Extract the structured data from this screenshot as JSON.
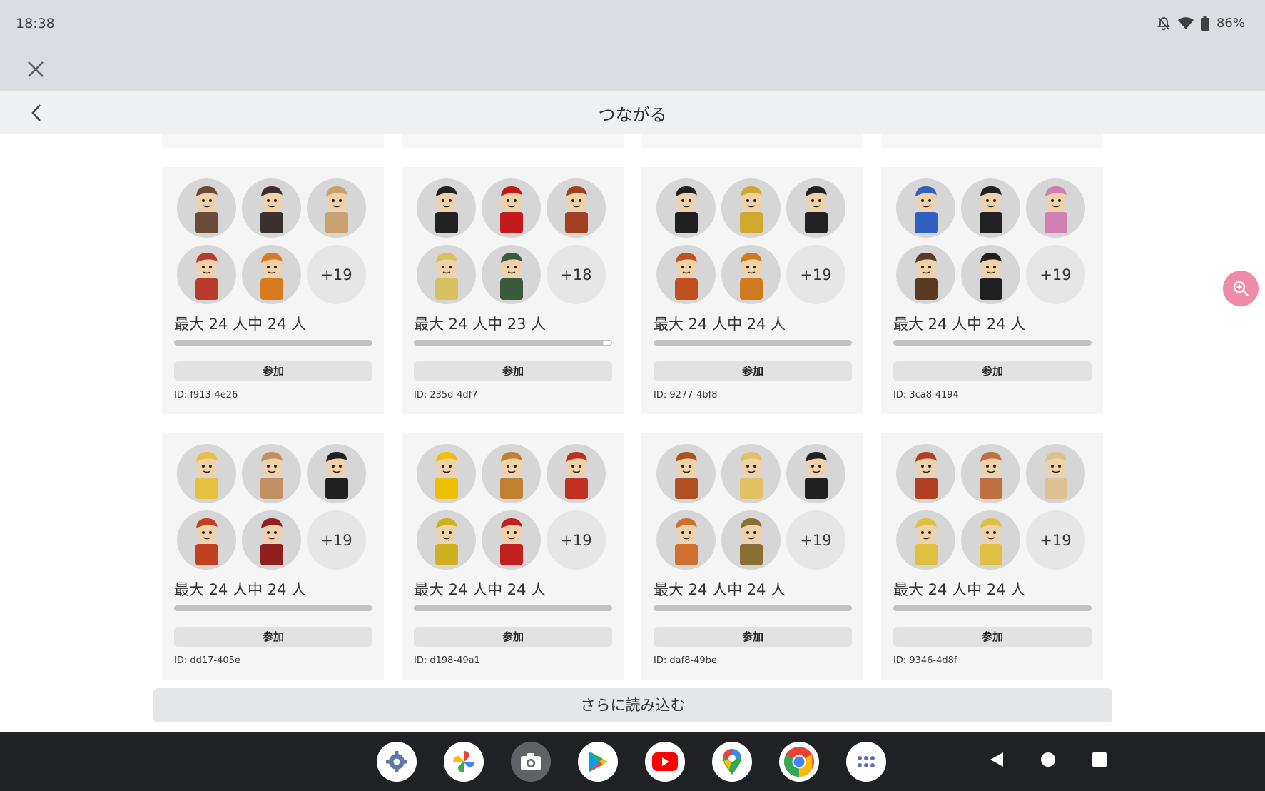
{
  "status_bar": {
    "time": "18:38",
    "battery": "86%"
  },
  "header": {
    "title": "つながる"
  },
  "servers": [
    {
      "avatar_colors": [
        "#6b4a3a",
        "#3a3030",
        "#c9a070",
        "#b83a2a",
        "#d87a20"
      ],
      "more": "+19",
      "count_text": "最大 24 人中 24 人",
      "fill": 1.0,
      "join_label": "参加",
      "id_text": "ID: f913-4e26"
    },
    {
      "avatar_colors": [
        "#222222",
        "#c21a1a",
        "#a04020",
        "#d8c060",
        "#3a5a3a"
      ],
      "more": "+18",
      "count_text": "最大 24 人中 23 人",
      "fill": 0.958,
      "join_label": "参加",
      "id_text": "ID: 235d-4df7"
    },
    {
      "avatar_colors": [
        "#202020",
        "#d0a830",
        "#222222",
        "#c05020",
        "#d07a20"
      ],
      "more": "+19",
      "count_text": "最大 24 人中 24 人",
      "fill": 1.0,
      "join_label": "参加",
      "id_text": "ID: 9277-4bf8"
    },
    {
      "avatar_colors": [
        "#3060c0",
        "#222222",
        "#d080b0",
        "#5a3a20",
        "#202020"
      ],
      "more": "+19",
      "count_text": "最大 24 人中 24 人",
      "fill": 1.0,
      "join_label": "参加",
      "id_text": "ID: 3ca8-4194"
    },
    {
      "avatar_colors": [
        "#e8c040",
        "#c09060",
        "#202020",
        "#c04020",
        "#902020"
      ],
      "more": "+19",
      "count_text": "最大 24 人中 24 人",
      "fill": 1.0,
      "join_label": "参加",
      "id_text": "ID: dd17-405e"
    },
    {
      "avatar_colors": [
        "#f0c000",
        "#c08030",
        "#c03020",
        "#d0b020",
        "#c02020"
      ],
      "more": "+19",
      "count_text": "最大 24 人中 24 人",
      "fill": 1.0,
      "join_label": "参加",
      "id_text": "ID: d198-49a1"
    },
    {
      "avatar_colors": [
        "#b05020",
        "#e0c060",
        "#202020",
        "#d07030",
        "#8a7030"
      ],
      "more": "+19",
      "count_text": "最大 24 人中 24 人",
      "fill": 1.0,
      "join_label": "参加",
      "id_text": "ID: daf8-49be"
    },
    {
      "avatar_colors": [
        "#b04020",
        "#c07040",
        "#e0c090",
        "#e0c040",
        "#e0c040"
      ],
      "more": "+19",
      "count_text": "最大 24 人中 24 人",
      "fill": 1.0,
      "join_label": "参加",
      "id_text": "ID: 9346-4d8f"
    }
  ],
  "load_more_label": "さらに読み込む",
  "dock": [
    "settings-icon",
    "photos-icon",
    "camera-icon",
    "play-store-icon",
    "youtube-icon",
    "maps-icon",
    "chrome-icon",
    "app-drawer-icon"
  ],
  "colors": {
    "accent_fab": "#f08aa9",
    "nav_bg": "#202124",
    "status_bg": "#dadde1"
  }
}
